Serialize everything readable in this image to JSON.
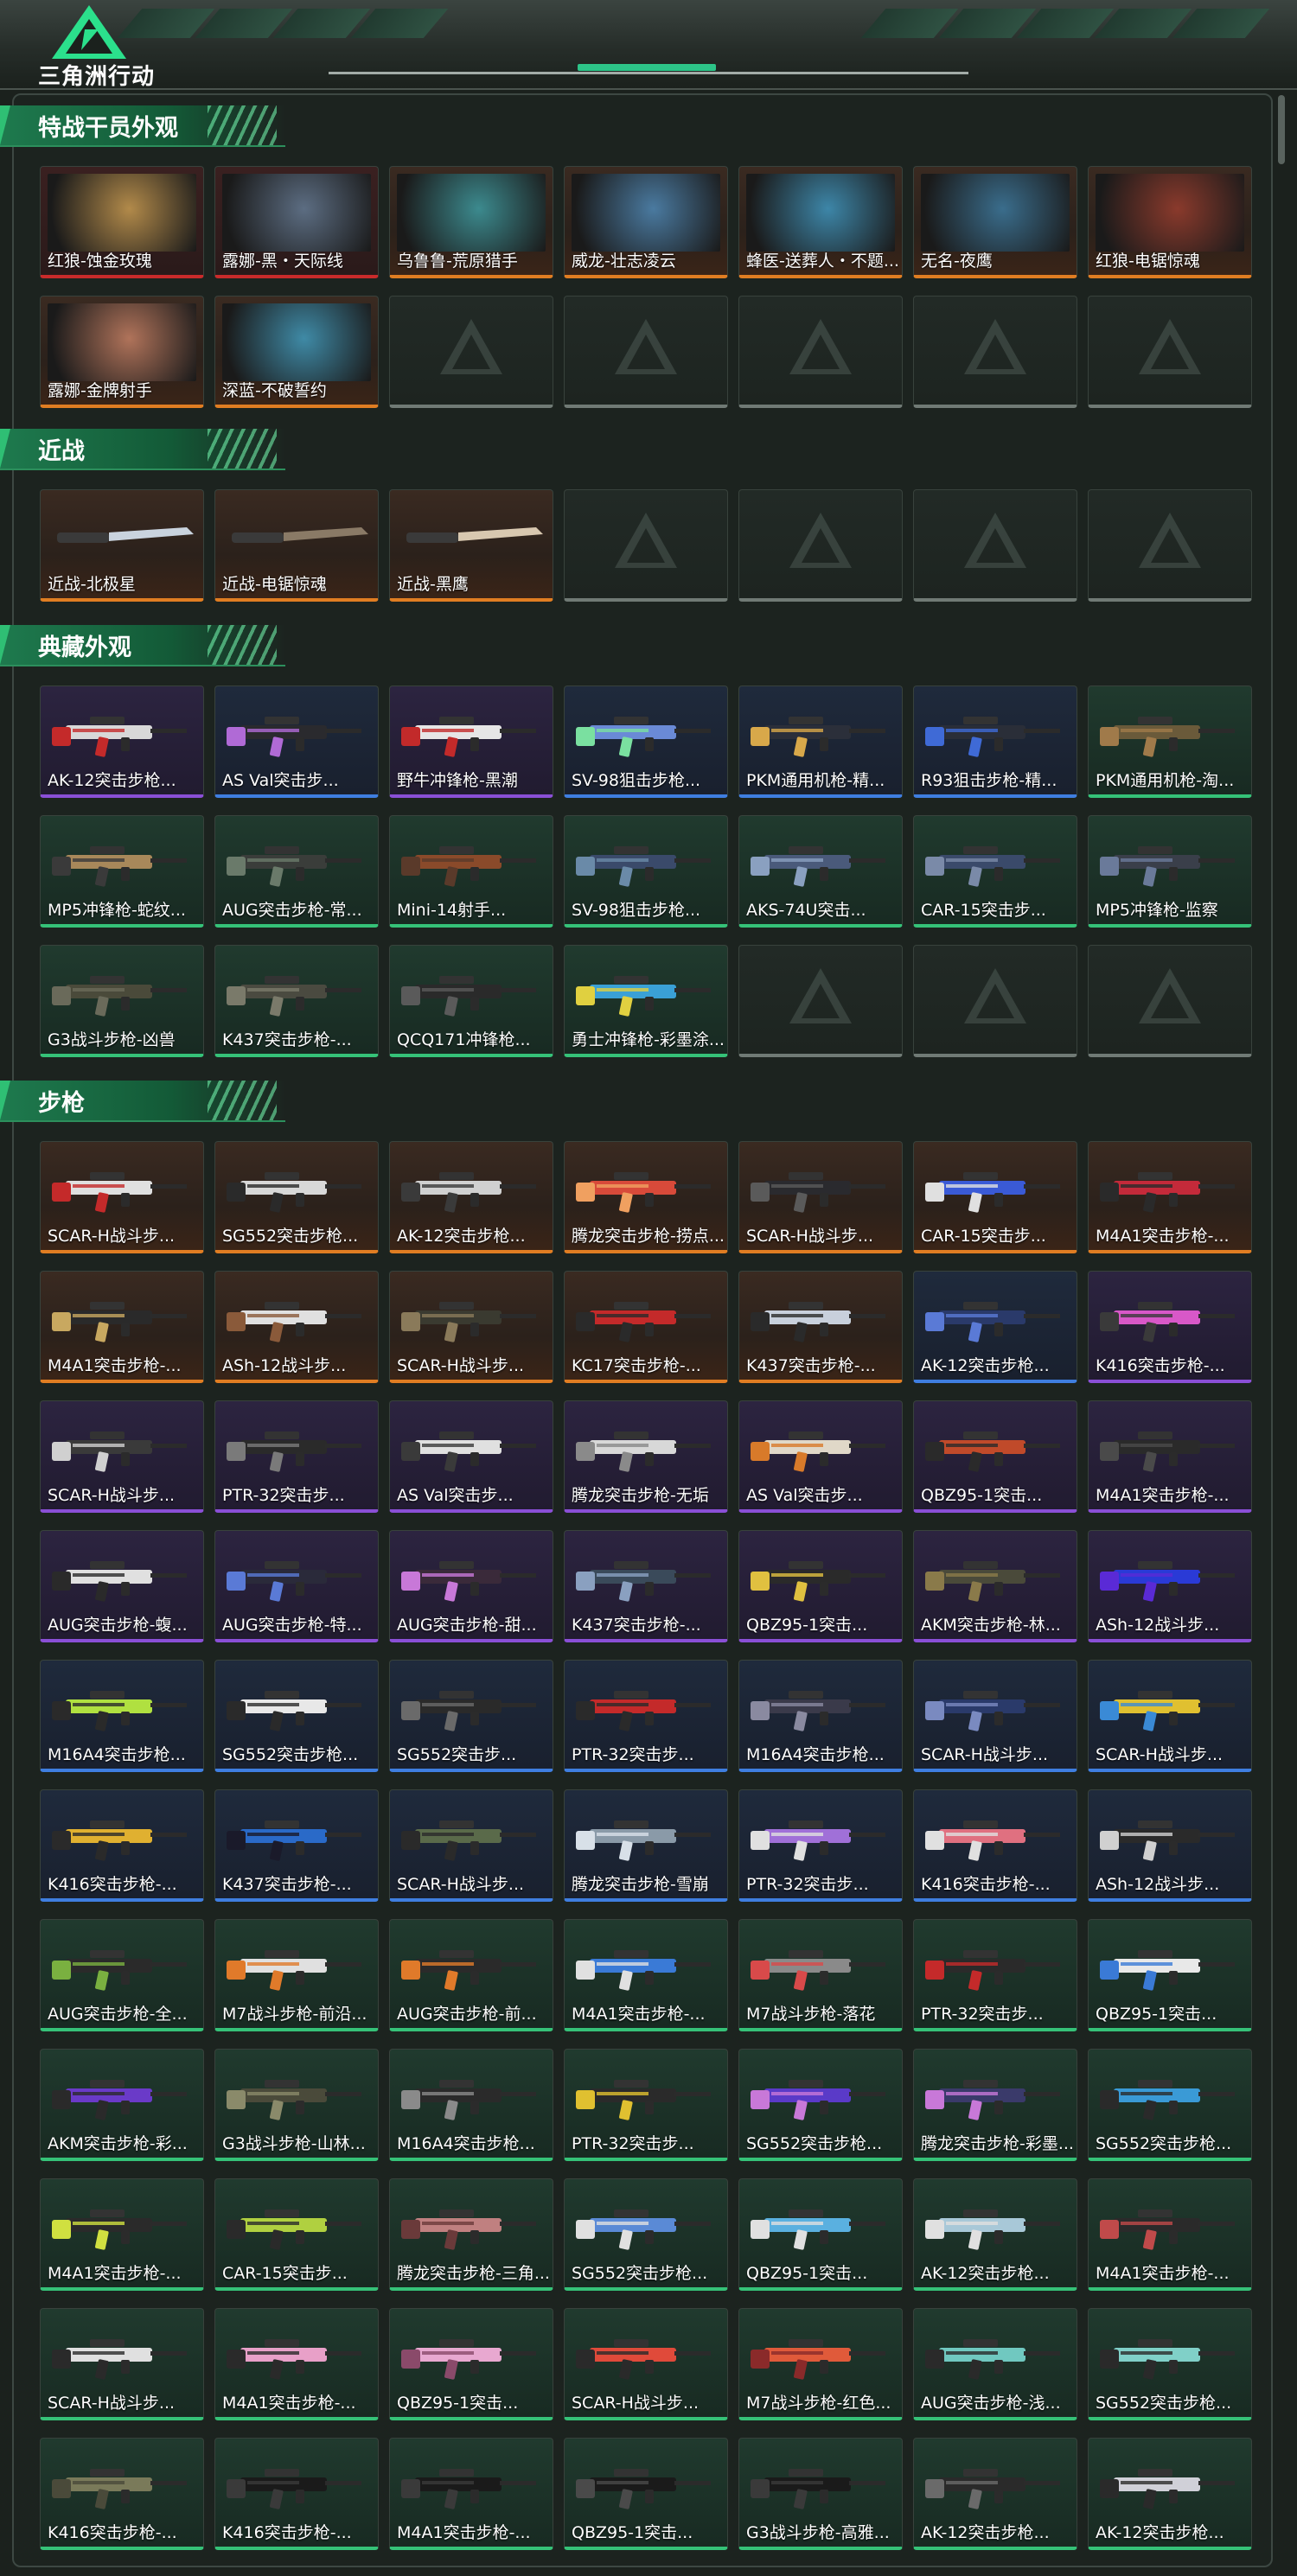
{
  "app": {
    "logo_text": "三角洲行动",
    "logo_icon": "delta-triangle-icon"
  },
  "sections": [
    {
      "title": "特战干员外观",
      "kind": "operator",
      "items": [
        {
          "label": "红狼-蚀金玫瑰",
          "rarity": "red",
          "tone": "#b28a4a"
        },
        {
          "label": "露娜-黑・天际线",
          "rarity": "red",
          "tone": "#5c6d82"
        },
        {
          "label": "乌鲁鲁-荒原猎手",
          "rarity": "orange",
          "tone": "#3c8a8e"
        },
        {
          "label": "威龙-壮志凌云",
          "rarity": "orange",
          "tone": "#4a7aa0"
        },
        {
          "label": "蜂医-送葬人・不题...",
          "rarity": "orange",
          "tone": "#3d86a8"
        },
        {
          "label": "无名-夜鹰",
          "rarity": "orange",
          "tone": "#3a6d8c"
        },
        {
          "label": "红狼-电锯惊魂",
          "rarity": "orange",
          "tone": "#8a3a2c"
        },
        {
          "label": "露娜-金牌射手",
          "rarity": "orange",
          "tone": "#b0735a"
        },
        {
          "label": "深蓝-不破誓约",
          "rarity": "orange",
          "tone": "#3f8aa6"
        },
        {
          "empty": true
        },
        {
          "empty": true
        },
        {
          "empty": true
        },
        {
          "empty": true
        },
        {
          "empty": true
        }
      ]
    },
    {
      "title": "近战",
      "kind": "melee",
      "items": [
        {
          "label": "近战-北极星",
          "rarity": "orange",
          "tone": "#c9d3de"
        },
        {
          "label": "近战-电锯惊魂",
          "rarity": "orange",
          "tone": "#8a7a66"
        },
        {
          "label": "近战-黑鹰",
          "rarity": "orange",
          "tone": "#d8c8b0"
        },
        {
          "empty": true
        },
        {
          "empty": true
        },
        {
          "empty": true
        },
        {
          "empty": true
        }
      ]
    },
    {
      "title": "典藏外观",
      "kind": "weapon",
      "items": [
        {
          "label": "AK-12突击步枪...",
          "rarity": "purple",
          "tone": "#d8d8d8",
          "accent": "#c42a2a"
        },
        {
          "label": "AS Val突击步...",
          "rarity": "blue",
          "tone": "#2a2a2e",
          "accent": "#b06ad6"
        },
        {
          "label": "野牛冲锋枪-黑潮",
          "rarity": "purple",
          "tone": "#e6e6e6",
          "accent": "#c22a2a"
        },
        {
          "label": "SV-98狙击步枪...",
          "rarity": "blue",
          "tone": "#6a8ad6",
          "accent": "#7ae0a0"
        },
        {
          "label": "PKM通用机枪-精...",
          "rarity": "blue",
          "tone": "#2b2f3a",
          "accent": "#d8a84a"
        },
        {
          "label": "R93狙击步枪-精...",
          "rarity": "blue",
          "tone": "#2a2e38",
          "accent": "#3f6ad6"
        },
        {
          "label": "PKM通用机枪-淘...",
          "rarity": "green",
          "tone": "#6a5a3a",
          "accent": "#a07a4a"
        },
        {
          "label": "MP5冲锋枪-蛇纹...",
          "rarity": "green",
          "tone": "#a8885a",
          "accent": "#3a3a3a"
        },
        {
          "label": "AUG突击步枪-常...",
          "rarity": "green",
          "tone": "#3a3d3a",
          "accent": "#6a7a6a"
        },
        {
          "label": "Mini-14射手...",
          "rarity": "green",
          "tone": "#8a4a2a",
          "accent": "#5a3a2a"
        },
        {
          "label": "SV-98狙击步枪...",
          "rarity": "green",
          "tone": "#3a4a6a",
          "accent": "#6a8aa8"
        },
        {
          "label": "AKS-74U突击...",
          "rarity": "green",
          "tone": "#4a5a7a",
          "accent": "#8aa0c0"
        },
        {
          "label": "CAR-15突击步...",
          "rarity": "green",
          "tone": "#3a4a6a",
          "accent": "#7a8aa8"
        },
        {
          "label": "MP5冲锋枪-监察",
          "rarity": "green",
          "tone": "#3a3f4a",
          "accent": "#6a7a9a"
        },
        {
          "label": "G3战斗步枪-凶兽",
          "rarity": "green",
          "tone": "#4a4a3a",
          "accent": "#6a6a5a"
        },
        {
          "label": "K437突击步枪-...",
          "rarity": "green",
          "tone": "#4a4a40",
          "accent": "#7a7a6a"
        },
        {
          "label": "QCQ171冲锋枪...",
          "rarity": "green",
          "tone": "#2a2a2a",
          "accent": "#5a5a5a"
        },
        {
          "label": "勇士冲锋枪-彩墨涂...",
          "rarity": "green",
          "tone": "#3aa0d6",
          "accent": "#e0d040"
        },
        {
          "empty": true
        },
        {
          "empty": true
        },
        {
          "empty": true
        }
      ]
    },
    {
      "title": "步枪",
      "kind": "weapon",
      "items": [
        {
          "label": "SCAR-H战斗步...",
          "rarity": "orange",
          "tone": "#e0e0e0",
          "accent": "#c42a2a"
        },
        {
          "label": "SG552突击步枪...",
          "rarity": "orange",
          "tone": "#d8d8d8",
          "accent": "#2a2a2a"
        },
        {
          "label": "AK-12突击步枪...",
          "rarity": "orange",
          "tone": "#d0d0d0",
          "accent": "#3a3a3a"
        },
        {
          "label": "腾龙突击步枪-捞点...",
          "rarity": "orange",
          "tone": "#d84a3a",
          "accent": "#f0a060"
        },
        {
          "label": "SCAR-H战斗步...",
          "rarity": "orange",
          "tone": "#2a2a2e",
          "accent": "#5a5a5a"
        },
        {
          "label": "CAR-15突击步...",
          "rarity": "orange",
          "tone": "#3a5ad6",
          "accent": "#e0e0e0"
        },
        {
          "label": "M4A1突击步枪-...",
          "rarity": "orange",
          "tone": "#c42a3a",
          "accent": "#2a2a2a"
        },
        {
          "label": "M4A1突击步枪-...",
          "rarity": "orange",
          "tone": "#2a2a2a",
          "accent": "#c8a860"
        },
        {
          "label": "ASh-12战斗步...",
          "rarity": "orange",
          "tone": "#e0e0e0",
          "accent": "#8a5a3a"
        },
        {
          "label": "SCAR-H战斗步...",
          "rarity": "orange",
          "tone": "#3a3a30",
          "accent": "#8a7a5a"
        },
        {
          "label": "KC17突击步枪-...",
          "rarity": "orange",
          "tone": "#c42a2a",
          "accent": "#2a2a2a"
        },
        {
          "label": "K437突击步枪-...",
          "rarity": "orange",
          "tone": "#c8d0dc",
          "accent": "#2a2a2a"
        },
        {
          "label": "AK-12突击步枪...",
          "rarity": "blue",
          "tone": "#2a3a6a",
          "accent": "#5a7ad6"
        },
        {
          "label": "K416突击步枪-...",
          "rarity": "purple",
          "tone": "#d858c8",
          "accent": "#3a3a3a"
        },
        {
          "label": "SCAR-H战斗步...",
          "rarity": "purple",
          "tone": "#3a3a3a",
          "accent": "#d0d0d0"
        },
        {
          "label": "PTR-32突击步...",
          "rarity": "purple",
          "tone": "#2a2a2a",
          "accent": "#7a7a7a"
        },
        {
          "label": "AS Val突击步...",
          "rarity": "purple",
          "tone": "#e0e0e0",
          "accent": "#3a3a3a"
        },
        {
          "label": "腾龙突击步枪-无垢",
          "rarity": "purple",
          "tone": "#d8d8d8",
          "accent": "#8a8a8a"
        },
        {
          "label": "AS Val突击步...",
          "rarity": "purple",
          "tone": "#e0d8c8",
          "accent": "#d87a2a"
        },
        {
          "label": "QBZ95-1突击...",
          "rarity": "purple",
          "tone": "#c04a2a",
          "accent": "#2a2a2a"
        },
        {
          "label": "M4A1突击步枪-...",
          "rarity": "purple",
          "tone": "#2a2a2a",
          "accent": "#4a4a4a"
        },
        {
          "label": "AUG突击步枪-蝮...",
          "rarity": "purple",
          "tone": "#e0e0e0",
          "accent": "#2a2a2a"
        },
        {
          "label": "AUG突击步枪-特...",
          "rarity": "purple",
          "tone": "#2a2a3a",
          "accent": "#5a7ad6"
        },
        {
          "label": "AUG突击步枪-甜...",
          "rarity": "purple",
          "tone": "#3a2a3a",
          "accent": "#c878d8"
        },
        {
          "label": "K437突击步枪-...",
          "rarity": "purple",
          "tone": "#3a4a5a",
          "accent": "#8aa0c0"
        },
        {
          "label": "QBZ95-1突击...",
          "rarity": "purple",
          "tone": "#2a2a2a",
          "accent": "#e0c040"
        },
        {
          "label": "AKM突击步枪-林...",
          "rarity": "purple",
          "tone": "#4a4a3a",
          "accent": "#8a7a4a"
        },
        {
          "label": "ASh-12战斗步...",
          "rarity": "purple",
          "tone": "#2a3ad6",
          "accent": "#5a2ad6"
        },
        {
          "label": "M16A4突击步枪...",
          "rarity": "blue",
          "tone": "#b0e040",
          "accent": "#2a2a2a"
        },
        {
          "label": "SG552突击步枪...",
          "rarity": "blue",
          "tone": "#e8e8e8",
          "accent": "#2a2a2a"
        },
        {
          "label": "SG552突击步...",
          "rarity": "blue",
          "tone": "#2a2a2a",
          "accent": "#6a6a6a"
        },
        {
          "label": "PTR-32突击步...",
          "rarity": "blue",
          "tone": "#c42a2a",
          "accent": "#2a2a2a"
        },
        {
          "label": "M16A4突击步枪...",
          "rarity": "blue",
          "tone": "#3a3a4a",
          "accent": "#8a8aa0"
        },
        {
          "label": "SCAR-H战斗步...",
          "rarity": "blue",
          "tone": "#2a3a6a",
          "accent": "#7a8ac0"
        },
        {
          "label": "SCAR-H战斗步...",
          "rarity": "blue",
          "tone": "#e0c030",
          "accent": "#3a8ad6"
        },
        {
          "label": "K416突击步枪-...",
          "rarity": "blue",
          "tone": "#e0b030",
          "accent": "#2a2a2a"
        },
        {
          "label": "K437突击步枪-...",
          "rarity": "blue",
          "tone": "#2a6ac8",
          "accent": "#1a1a2a"
        },
        {
          "label": "SCAR-H战斗步...",
          "rarity": "blue",
          "tone": "#5a6a4a",
          "accent": "#2a2a2a"
        },
        {
          "label": "腾龙突击步枪-雪崩",
          "rarity": "blue",
          "tone": "#8a9aa8",
          "accent": "#d8e0e8"
        },
        {
          "label": "PTR-32突击步...",
          "rarity": "blue",
          "tone": "#a070d8",
          "accent": "#e0e0e0"
        },
        {
          "label": "K416突击步枪-...",
          "rarity": "blue",
          "tone": "#e07080",
          "accent": "#e0e0e0"
        },
        {
          "label": "ASh-12战斗步...",
          "rarity": "blue",
          "tone": "#2a2a2a",
          "accent": "#d0d0d0"
        },
        {
          "label": "AUG突击步枪-全...",
          "rarity": "green",
          "tone": "#2a2a2a",
          "accent": "#7ab040"
        },
        {
          "label": "M7战斗步枪-前沿...",
          "rarity": "green",
          "tone": "#e0e0e0",
          "accent": "#e07a2a"
        },
        {
          "label": "AUG突击步枪-前...",
          "rarity": "green",
          "tone": "#2a2a2a",
          "accent": "#e07a2a"
        },
        {
          "label": "M4A1突击步枪-...",
          "rarity": "green",
          "tone": "#3a7ad6",
          "accent": "#e0e0e0"
        },
        {
          "label": "M7战斗步枪-落花",
          "rarity": "green",
          "tone": "#8a8a8a",
          "accent": "#d84a4a"
        },
        {
          "label": "PTR-32突击步...",
          "rarity": "green",
          "tone": "#2a2a2a",
          "accent": "#c42a2a"
        },
        {
          "label": "QBZ95-1突击...",
          "rarity": "green",
          "tone": "#e8e8e8",
          "accent": "#3a7ad6"
        },
        {
          "label": "AKM突击步枪-彩...",
          "rarity": "green",
          "tone": "#6a3ac8",
          "accent": "#2a2a2a"
        },
        {
          "label": "G3战斗步枪-山林...",
          "rarity": "green",
          "tone": "#4a4a3a",
          "accent": "#8a8a6a"
        },
        {
          "label": "M16A4突击步枪...",
          "rarity": "green",
          "tone": "#2a2a2a",
          "accent": "#8a8a8a"
        },
        {
          "label": "PTR-32突击步...",
          "rarity": "green",
          "tone": "#2a2a2a",
          "accent": "#e0c030"
        },
        {
          "label": "SG552突击步枪...",
          "rarity": "green",
          "tone": "#5a3ac8",
          "accent": "#c878d8"
        },
        {
          "label": "腾龙突击步枪-彩墨...",
          "rarity": "green",
          "tone": "#3a3a6a",
          "accent": "#c878d8"
        },
        {
          "label": "SG552突击步枪...",
          "rarity": "green",
          "tone": "#3a9ad6",
          "accent": "#2a2a2a"
        },
        {
          "label": "M4A1突击步枪-...",
          "rarity": "green",
          "tone": "#2a2a2a",
          "accent": "#d0e040"
        },
        {
          "label": "CAR-15突击步...",
          "rarity": "green",
          "tone": "#b0d040",
          "accent": "#2a2a2a"
        },
        {
          "label": "腾龙突击步枪-三角...",
          "rarity": "green",
          "tone": "#c08080",
          "accent": "#6a3a3a"
        },
        {
          "label": "SG552突击步枪...",
          "rarity": "green",
          "tone": "#5a8ad6",
          "accent": "#e0e0e0"
        },
        {
          "label": "QBZ95-1突击...",
          "rarity": "green",
          "tone": "#5ab0e0",
          "accent": "#e0e0e0"
        },
        {
          "label": "AK-12突击步枪...",
          "rarity": "green",
          "tone": "#a8c8d8",
          "accent": "#e0e0e0"
        },
        {
          "label": "M4A1突击步枪-...",
          "rarity": "green",
          "tone": "#2a2a2a",
          "accent": "#c04a4a"
        },
        {
          "label": "SCAR-H战斗步...",
          "rarity": "green",
          "tone": "#e0e0e0",
          "accent": "#2a2a2a"
        },
        {
          "label": "M4A1突击步枪-...",
          "rarity": "green",
          "tone": "#e8a0c8",
          "accent": "#2a2a2a"
        },
        {
          "label": "QBZ95-1突击...",
          "rarity": "green",
          "tone": "#e8a8d0",
          "accent": "#8a4a6a"
        },
        {
          "label": "SCAR-H战斗步...",
          "rarity": "green",
          "tone": "#e04a3a",
          "accent": "#2a2a2a"
        },
        {
          "label": "M7战斗步枪-红色...",
          "rarity": "green",
          "tone": "#e05a3a",
          "accent": "#8a2a2a"
        },
        {
          "label": "AUG突击步枪-浅...",
          "rarity": "green",
          "tone": "#70c8c0",
          "accent": "#2a2a2a"
        },
        {
          "label": "SG552突击步枪...",
          "rarity": "green",
          "tone": "#80d0c8",
          "accent": "#2a2a2a"
        },
        {
          "label": "K416突击步枪-...",
          "rarity": "green",
          "tone": "#7a7a5a",
          "accent": "#4a4a3a"
        },
        {
          "label": "K416突击步枪-...",
          "rarity": "green",
          "tone": "#1a1a1a",
          "accent": "#3a3a3a"
        },
        {
          "label": "M4A1突击步枪-...",
          "rarity": "green",
          "tone": "#1a1a1a",
          "accent": "#3a3a3a"
        },
        {
          "label": "QBZ95-1突击...",
          "rarity": "green",
          "tone": "#1a1a1a",
          "accent": "#4a4a4a"
        },
        {
          "label": "G3战斗步枪-高雅...",
          "rarity": "green",
          "tone": "#1a1a1a",
          "accent": "#3a3a3a"
        },
        {
          "label": "AK-12突击步枪...",
          "rarity": "green",
          "tone": "#2a2a2a",
          "accent": "#6a6a6a"
        },
        {
          "label": "AK-12突击步枪...",
          "rarity": "green",
          "tone": "#d0d0d8",
          "accent": "#2a2a2a"
        }
      ]
    }
  ],
  "colors": {
    "rarity_orange": "#e07d22",
    "rarity_red": "#c92b2b",
    "rarity_purple": "#8a4fd6",
    "rarity_blue": "#3f7ee0",
    "rarity_green": "#35c278",
    "section_green": "#1e7a4e"
  }
}
